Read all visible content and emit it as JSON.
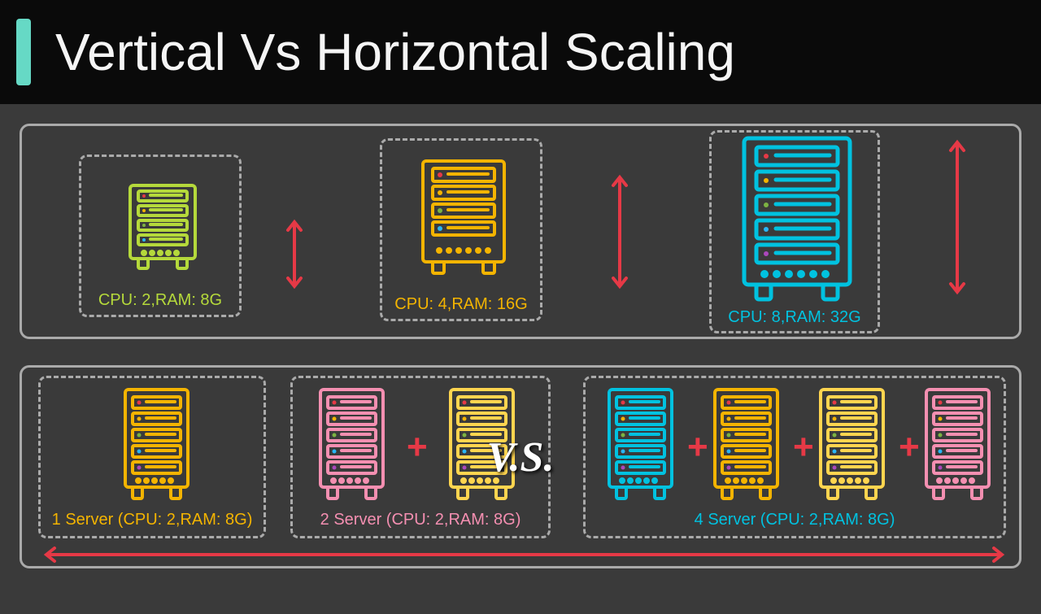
{
  "title": "Vertical Vs Horizontal Scaling",
  "vs_label": "V.S.",
  "vertical": {
    "servers": [
      {
        "label": "CPU: 2,RAM: 8G",
        "color": "#b5d93b"
      },
      {
        "label": "CPU: 4,RAM: 16G",
        "color": "#f4b400"
      },
      {
        "label": "CPU: 8,RAM: 32G",
        "color": "#00c2e0"
      }
    ]
  },
  "horizontal": {
    "groups": [
      {
        "label": "1 Server (CPU: 2,RAM: 8G)",
        "count": 1
      },
      {
        "label": "2 Server (CPU: 2,RAM: 8G)",
        "count": 2
      },
      {
        "label": "4 Server (CPU: 2,RAM: 8G)",
        "count": 4
      }
    ]
  },
  "colors": {
    "green": "#b5d93b",
    "orange": "#f4b400",
    "cyan": "#00c2e0",
    "pink": "#f48fb1",
    "yellow": "#ffd54f",
    "red": "#e63946"
  }
}
